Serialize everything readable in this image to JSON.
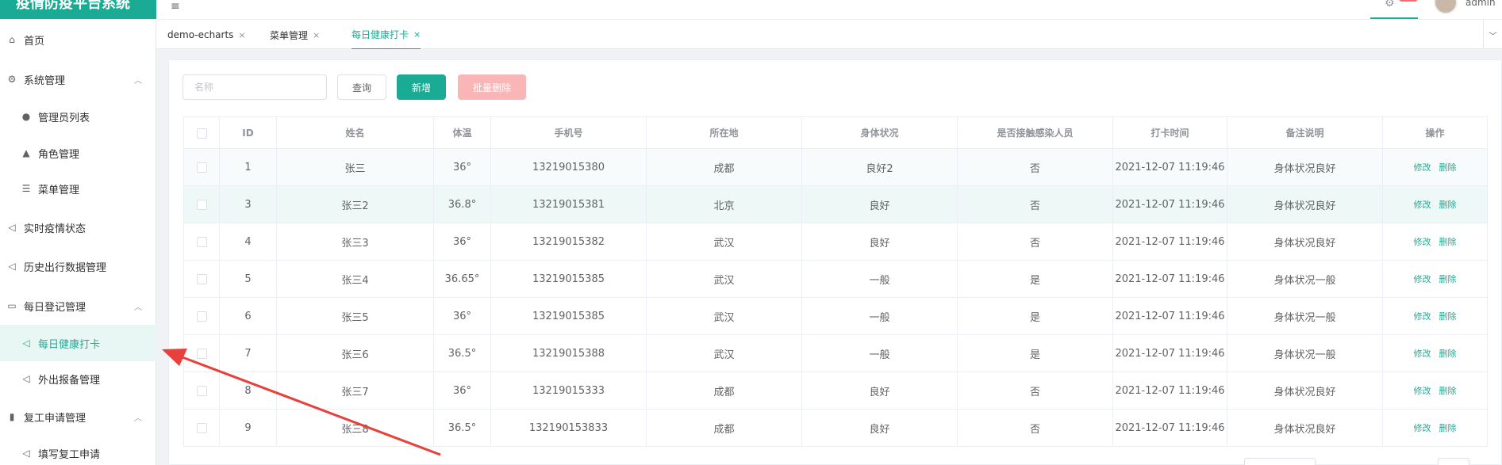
{
  "app": {
    "title": "疫情防疫平台系统"
  },
  "header": {
    "user": "admin"
  },
  "sidebar": {
    "items": [
      {
        "label": "首页",
        "icon": "home-icon"
      },
      {
        "label": "系统管理",
        "icon": "gear-icon",
        "arrow": "^"
      },
      {
        "label": "管理员列表",
        "icon": "user-icon"
      },
      {
        "label": "角色管理",
        "icon": "role-icon"
      },
      {
        "label": "菜单管理",
        "icon": "menu-list-icon"
      },
      {
        "label": "实时疫情状态",
        "icon": "send-icon"
      },
      {
        "label": "历史出行数据管理",
        "icon": "send-icon"
      },
      {
        "label": "每日登记管理",
        "icon": "message-icon",
        "arrow": "^"
      },
      {
        "label": "每日健康打卡",
        "icon": "send-icon"
      },
      {
        "label": "外出报备管理",
        "icon": "send-icon"
      },
      {
        "label": "复工申请管理",
        "icon": "chart-icon",
        "arrow": "^"
      },
      {
        "label": "填写复工申请",
        "icon": "send-icon"
      }
    ]
  },
  "tabs": [
    {
      "label": "demo-echarts",
      "close": "×"
    },
    {
      "label": "菜单管理",
      "close": "×"
    },
    {
      "label": "每日健康打卡",
      "close": "×"
    }
  ],
  "toolbar": {
    "search_placeholder": "名称",
    "query_label": "查询",
    "add_label": "新增",
    "batch_delete_label": "批量删除"
  },
  "table": {
    "headers": [
      "ID",
      "姓名",
      "体温",
      "手机号",
      "所在地",
      "身体状况",
      "是否接触感染人员",
      "打卡时间",
      "备注说明",
      "操作"
    ],
    "edit_label": "修改",
    "delete_label": "删除",
    "rows": [
      [
        "1",
        "张三",
        "36°",
        "13219015380",
        "成都",
        "良好2",
        "否",
        "2021-12-07 11:19:46",
        "身体状况良好"
      ],
      [
        "3",
        "张三2",
        "36.8°",
        "13219015381",
        "北京",
        "良好",
        "否",
        "2021-12-07 11:19:46",
        "身体状况良好"
      ],
      [
        "4",
        "张三3",
        "36°",
        "13219015382",
        "武汉",
        "良好",
        "否",
        "2021-12-07 11:19:46",
        "身体状况良好"
      ],
      [
        "5",
        "张三4",
        "36.65°",
        "13219015385",
        "武汉",
        "一般",
        "是",
        "2021-12-07 11:19:46",
        "身体状况一般"
      ],
      [
        "6",
        "张三5",
        "36°",
        "13219015385",
        "武汉",
        "一般",
        "是",
        "2021-12-07 11:19:46",
        "身体状况一般"
      ],
      [
        "7",
        "张三6",
        "36.5°",
        "13219015388",
        "武汉",
        "一般",
        "是",
        "2021-12-07 11:19:46",
        "身体状况一般"
      ],
      [
        "8",
        "张三7",
        "36°",
        "13219015333",
        "成都",
        "良好",
        "否",
        "2021-12-07 11:19:46",
        "身体状况良好"
      ],
      [
        "9",
        "张三8",
        "36.5°",
        "132190153833",
        "成都",
        "良好",
        "否",
        "2021-12-07 11:19:46",
        "身体状况良好"
      ]
    ]
  },
  "colors": {
    "accent": "#1aab94",
    "danger_light": "#fab6b6",
    "arrow": "#e8403a"
  }
}
